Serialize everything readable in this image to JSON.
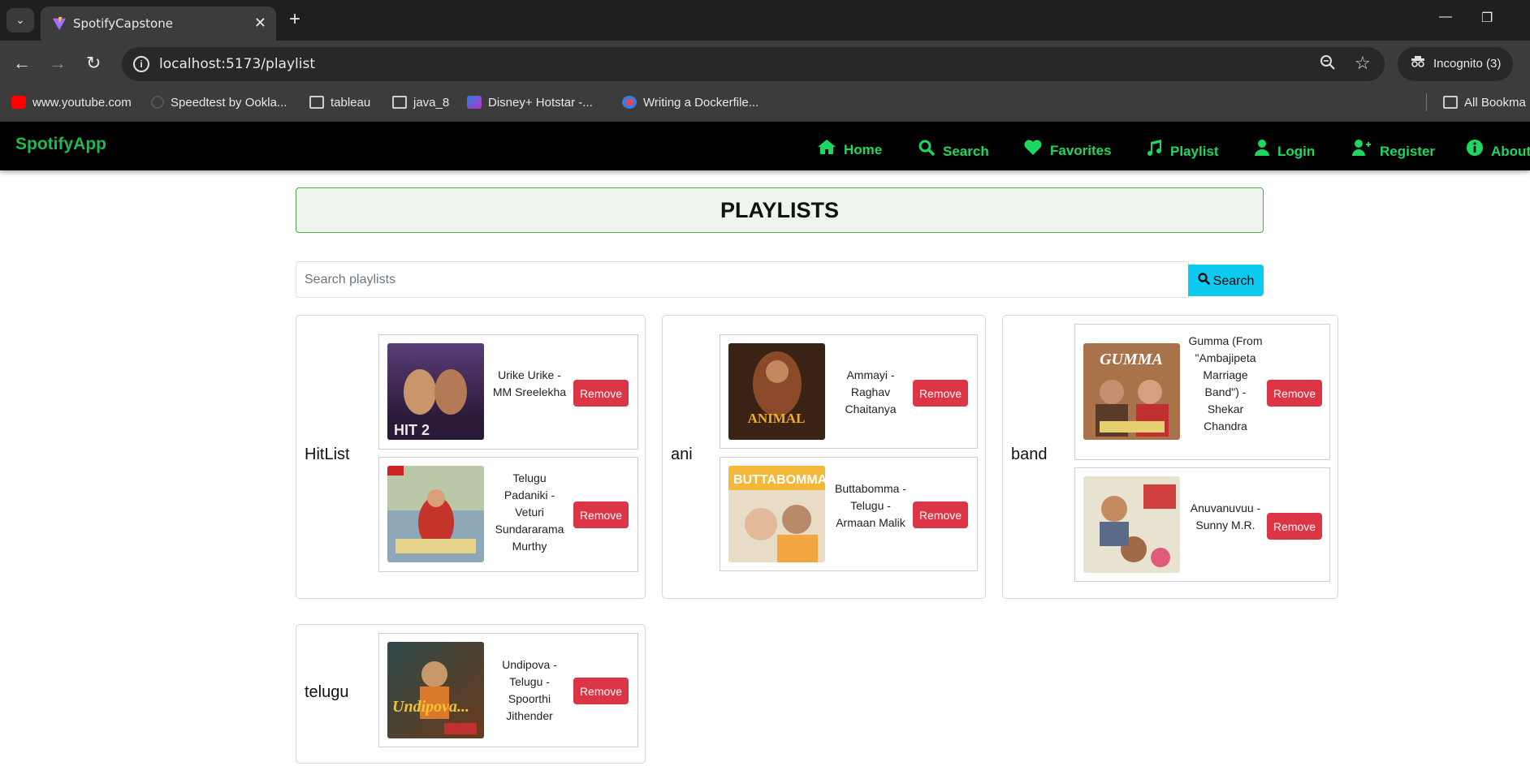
{
  "browser": {
    "tab_title": "SpotifyCapstone",
    "url": "localhost:5173/playlist",
    "incognito_label": "Incognito (3)",
    "bookmarks": [
      "www.youtube.com",
      "Speedtest by Ookla...",
      "tableau",
      "java_8",
      "Disney+ Hotstar -...",
      "Writing a Dockerfile...",
      "All Bookma"
    ]
  },
  "app": {
    "brand": "SpotifyApp",
    "brand_color": "#1db954",
    "nav": [
      {
        "label": "Home",
        "icon": "home-icon"
      },
      {
        "label": "Search",
        "icon": "search-icon"
      },
      {
        "label": "Favorites",
        "icon": "heart-icon"
      },
      {
        "label": "Playlist",
        "icon": "music-note-icon"
      },
      {
        "label": "Login",
        "icon": "user-icon"
      },
      {
        "label": "Register",
        "icon": "user-plus-icon"
      },
      {
        "label": "About",
        "icon": "info-icon"
      }
    ]
  },
  "page": {
    "title": "PLAYLISTS",
    "search_placeholder": "Search playlists",
    "search_button": "Search",
    "remove_label": "Remove",
    "remove_color": "#dc3545",
    "search_button_color": "#0dcaf0"
  },
  "playlists": [
    {
      "name": "HitList",
      "songs": [
        {
          "title": "Urike Urike - MM Sreelekha",
          "cover_text": "HIT 2"
        },
        {
          "title": "Telugu Padaniki - Veturi Sundararama Murthy",
          "cover_text": ""
        }
      ]
    },
    {
      "name": "ani",
      "songs": [
        {
          "title": "Ammayi - Raghav Chaitanya",
          "cover_text": "ANIMAL"
        },
        {
          "title": "Buttabomma - Telugu - Armaan Malik",
          "cover_text": "BUTTABOMMA"
        }
      ]
    },
    {
      "name": "band",
      "songs": [
        {
          "title": "Gumma (From \"Ambajipeta Marriage Band\") - Shekar Chandra",
          "cover_text": "GUMMA"
        },
        {
          "title": "Anuvanuvuu - Sunny M.R.",
          "cover_text": ""
        }
      ]
    },
    {
      "name": "telugu",
      "songs": [
        {
          "title": "Undipova - Telugu - Spoorthi Jithender",
          "cover_text": "Undipova..."
        }
      ]
    }
  ]
}
